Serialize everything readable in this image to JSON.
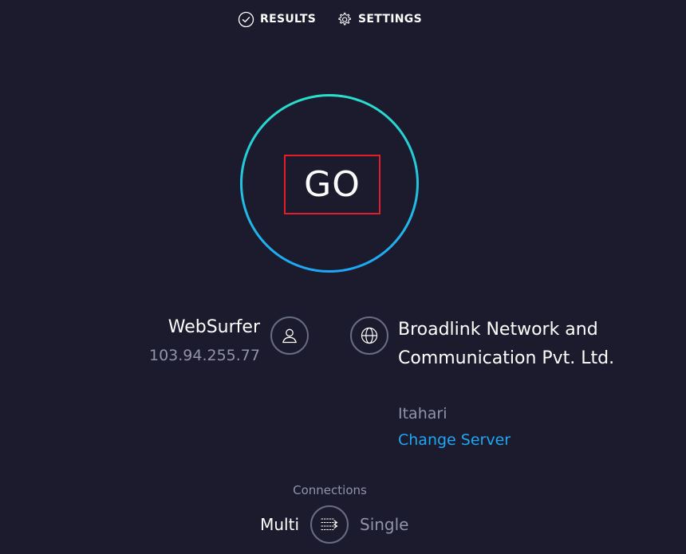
{
  "nav": {
    "results_label": "RESULTS",
    "settings_label": "SETTINGS",
    "results_icon": "check-circle-icon",
    "settings_icon": "gear-icon"
  },
  "go_button": {
    "label": "GO",
    "ring_gradient": [
      "#28e0c9",
      "#1ea7f5"
    ],
    "highlight_border_color": "#e31d2b"
  },
  "client": {
    "name": "WebSurfer",
    "ip": "103.94.255.77",
    "icon": "user-icon"
  },
  "server": {
    "isp": "Broadlink Network and Communication Pvt. Ltd.",
    "location": "Itahari",
    "change_server_label": "Change Server",
    "icon": "globe-icon"
  },
  "connections": {
    "title": "Connections",
    "multi_label": "Multi",
    "single_label": "Single",
    "selected": "Multi",
    "icon": "connections-toggle-icon"
  },
  "colors": {
    "background": "#1c1b2e",
    "accent_link": "#1ea7f5",
    "muted_text": "#9193a8"
  }
}
